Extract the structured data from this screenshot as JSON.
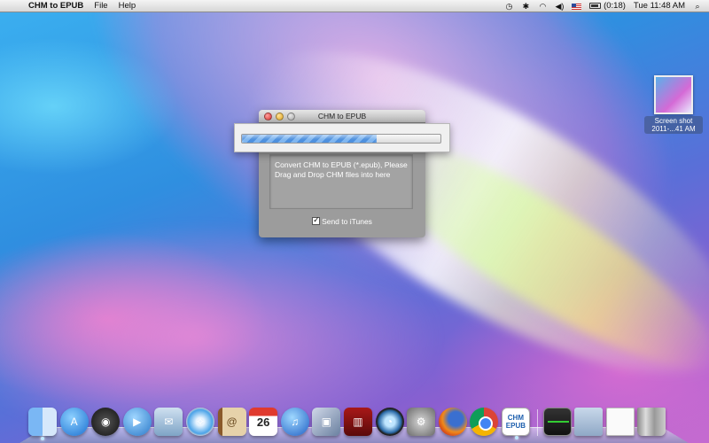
{
  "menubar": {
    "app_name": "CHM to EPUB",
    "menus": [
      "File",
      "Help"
    ],
    "battery_text": "(0:18)",
    "clock": "Tue 11:48 AM"
  },
  "desktop": {
    "file_label_1": "Screen shot",
    "file_label_2": "2011-...41 AM"
  },
  "window": {
    "title": "CHM to EPUB",
    "instructions": "Convert CHM to EPUB (*.epub), Please Drag and Drop CHM files into here",
    "checkbox_label": "Send to iTunes",
    "send_to_itunes_checked": true
  },
  "progress": {
    "value_percent": 68
  },
  "dock": {
    "apps": [
      "finder-icon",
      "app-store-icon",
      "dashboard-icon",
      "facetime-icon",
      "mail-icon",
      "safari-icon",
      "address-book-icon",
      "ical-icon",
      "itunes-icon",
      "iphoto-icon",
      "photo-booth-icon",
      "time-machine-icon",
      "system-preferences-icon",
      "firefox-icon",
      "chrome-icon",
      "chm-to-epub-icon"
    ],
    "ical_day": "26",
    "chm_icon_text_1": "CHM",
    "chm_icon_text_2": "EPUB"
  }
}
